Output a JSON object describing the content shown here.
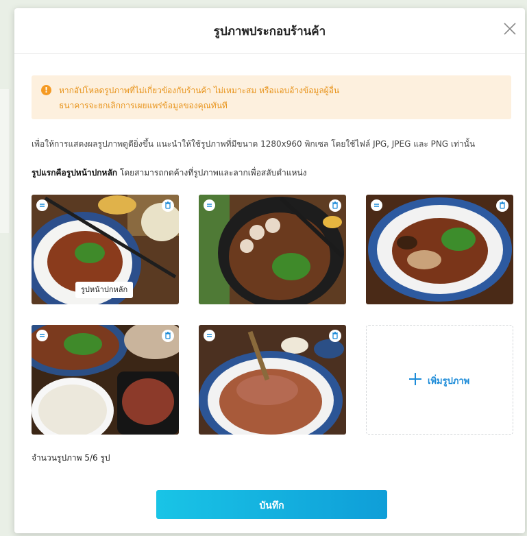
{
  "modal": {
    "title": "รูปภาพประกอบร้านค้า",
    "close_icon": "close-icon"
  },
  "alert": {
    "icon": "warning-icon",
    "icon_glyph": "!",
    "line1": "หากอัปโหลดรูปภาพที่ไม่เกี่ยวข้องกับร้านค้า ไม่เหมาะสม หรือแอบอ้างข้อมูลผู้อื่น",
    "line2": "ธนาคารจะยกเลิกการเผยแพร่ข้อมูลของคุณทันที",
    "color": "#e8941c",
    "background": "#fdf0de"
  },
  "hint": "เพื่อให้การแสดงผลรูปภาพดูดียิ่งขึ้น แนะนำให้ใช้รูปภาพที่มีขนาด 1280x960 พิกเซล โดยใช้ไฟล์ JPG, JPEG และ PNG เท่านั้น",
  "primary_note": {
    "bold": "รูปแรกคือรูปหน้าปกหลัก",
    "rest": "โดยสามารถกดค้างที่รูปภาพและลากเพื่อสลับตำแหน่ง"
  },
  "photos": [
    {
      "id": "photo-1",
      "cover_label": "รูปหน้าปกหลัก",
      "handle_icon": "drag-handle-icon",
      "delete_icon": "trash-icon"
    },
    {
      "id": "photo-2",
      "handle_icon": "drag-handle-icon",
      "delete_icon": "trash-icon"
    },
    {
      "id": "photo-3",
      "handle_icon": "drag-handle-icon",
      "delete_icon": "trash-icon"
    },
    {
      "id": "photo-4",
      "handle_icon": "drag-handle-icon",
      "delete_icon": "trash-icon"
    },
    {
      "id": "photo-5",
      "handle_icon": "drag-handle-icon",
      "delete_icon": "trash-icon"
    }
  ],
  "add_tile": {
    "icon": "plus-icon",
    "label": "เพิ่มรูปภาพ"
  },
  "count": "จำนวนรูปภาพ 5/6 รูป",
  "save_button": "บันทึก",
  "colors": {
    "accent": "#1c8bd8",
    "button_gradient_start": "#19c4e6",
    "button_gradient_end": "#0f9ed8"
  }
}
